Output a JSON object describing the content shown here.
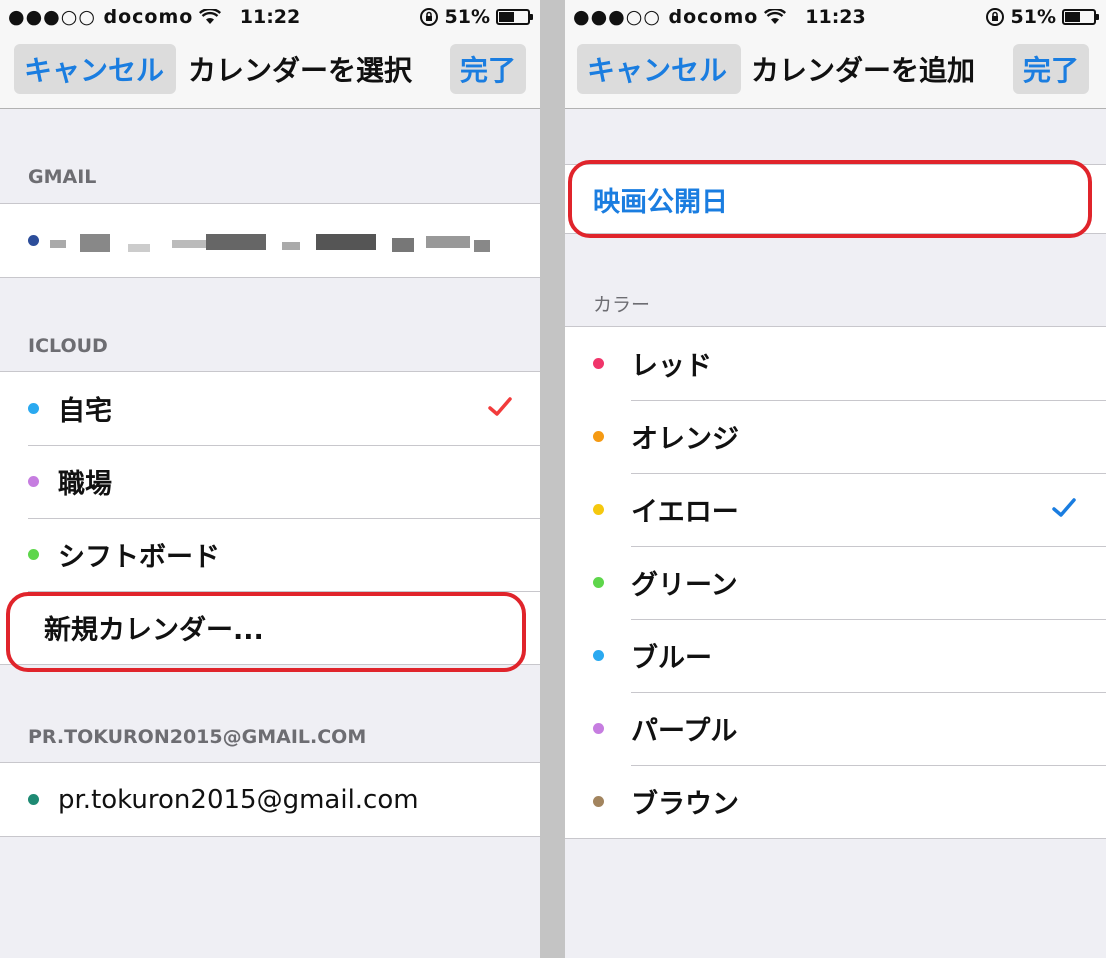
{
  "left_screen": {
    "status": {
      "signal": "●●●○○ docomo",
      "time": "11:22",
      "battery": "51%"
    },
    "nav": {
      "cancel": "キャンセル",
      "title": "カレンダーを選択",
      "done": "完了"
    },
    "sections": {
      "gmail": {
        "header": "GMAIL"
      },
      "icloud": {
        "header": "ICLOUD",
        "items": [
          {
            "label": "自宅",
            "color": "#2aa9f0",
            "checked": true
          },
          {
            "label": "職場",
            "color": "#c67de0"
          },
          {
            "label": "シフトボード",
            "color": "#5ed64b"
          }
        ],
        "new_calendar": "新規カレンダー..."
      },
      "account": {
        "header": "PR.TOKURON2015@GMAIL.COM",
        "item": {
          "label": "pr.tokuron2015@gmail.com",
          "color": "#1e8a73"
        }
      }
    },
    "check_color": "#f23b3b"
  },
  "right_screen": {
    "status": {
      "signal": "●●●○○ docomo",
      "time": "11:23",
      "battery": "51%"
    },
    "nav": {
      "cancel": "キャンセル",
      "title": "カレンダーを追加",
      "done": "完了"
    },
    "name_field": {
      "value": "映画公開日"
    },
    "color_section": {
      "header": "カラー",
      "options": [
        {
          "label": "レッド",
          "color": "#f0356a"
        },
        {
          "label": "オレンジ",
          "color": "#f59a13"
        },
        {
          "label": "イエロー",
          "color": "#f5c80e",
          "checked": true
        },
        {
          "label": "グリーン",
          "color": "#5ed64b"
        },
        {
          "label": "ブルー",
          "color": "#2aa9f0"
        },
        {
          "label": "パープル",
          "color": "#c67de0"
        },
        {
          "label": "ブラウン",
          "color": "#a2845e"
        }
      ]
    },
    "check_color": "#1a7de0"
  },
  "colors": {
    "accent": "#1a7de0",
    "highlight": "#e0242b",
    "gmail_dot": "#2c4d9a"
  }
}
